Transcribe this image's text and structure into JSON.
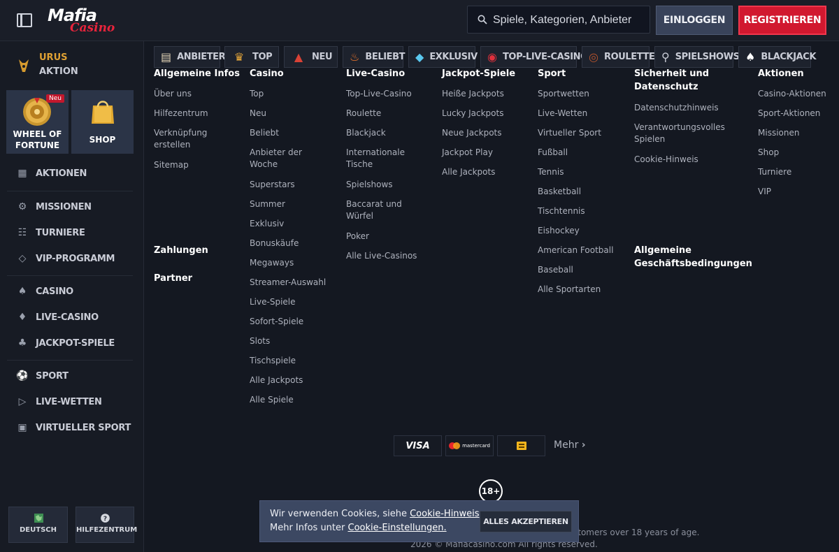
{
  "header": {
    "logo_top": "Mafia",
    "logo_bottom": "Casino",
    "search_placeholder": "Spiele, Kategorien, Anbieter",
    "login_label": "EINLOGGEN",
    "register_label": "REGISTRIEREN"
  },
  "sidebar": {
    "promo_title": "URUS",
    "promo_subtitle": "AKTION",
    "tiles": [
      {
        "label_line1": "WHEEL OF",
        "label_line2": "FORTUNE",
        "badge": "Neu",
        "icon": "wheel-icon"
      },
      {
        "label_line1": "SHOP",
        "label_line2": "",
        "badge": "",
        "icon": "shopping-bag-icon"
      }
    ],
    "items": [
      {
        "label": "AKTIONEN",
        "icon": "gift-icon"
      },
      {
        "label": "MISSIONEN",
        "icon": "gear-icon"
      },
      {
        "label": "TURNIERE",
        "icon": "tournament-icon"
      },
      {
        "label": "VIP-PROGRAMM",
        "icon": "diamond-icon"
      },
      {
        "label": "CASINO",
        "icon": "spade-icon"
      },
      {
        "label": "LIVE-CASINO",
        "icon": "cards-icon"
      },
      {
        "label": "JACKPOT-SPIELE",
        "icon": "clover-icon"
      },
      {
        "label": "SPORT",
        "icon": "football-icon"
      },
      {
        "label": "LIVE-WETTEN",
        "icon": "live-icon"
      },
      {
        "label": "VIRTUELLER SPORT",
        "icon": "virtual-sport-icon"
      }
    ],
    "language_label": "DEUTSCH",
    "help_label": "HILFEZENTRUM"
  },
  "categories": [
    {
      "label": "ANBIETER",
      "icon": "provider-icon"
    },
    {
      "label": "TOP",
      "icon": "crown-icon"
    },
    {
      "label": "NEU",
      "icon": "megaphone-icon"
    },
    {
      "label": "BELIEBT",
      "icon": "flame-icon"
    },
    {
      "label": "EXKLUSIV",
      "icon": "gem-icon"
    },
    {
      "label": "TOP-LIVE-CASINO",
      "icon": "chip-icon"
    },
    {
      "label": "ROULETTE",
      "icon": "roulette-icon"
    },
    {
      "label": "SPIELSHOWS",
      "icon": "microphone-icon"
    },
    {
      "label": "BLACKJACK",
      "icon": "playing-cards-icon"
    }
  ],
  "footer": {
    "columns": [
      {
        "heading": "Allgemeine Infos",
        "links": [
          "Über uns",
          "Hilfezentrum",
          "Verknüpfung erstellen",
          "Sitemap"
        ]
      },
      {
        "heading": "Casino",
        "links": [
          "Top",
          "Neu",
          "Beliebt",
          "Anbieter der Woche",
          "Superstars",
          "Summer",
          "Exklusiv",
          "Bonuskäufe",
          "Megaways",
          "Streamer-Auswahl",
          "Live-Spiele",
          "Sofort-Spiele",
          "Slots",
          "Tischspiele",
          "Alle Jackpots",
          "Alle Spiele"
        ]
      },
      {
        "heading": "Live-Casino",
        "links": [
          "Top-Live-Casino",
          "Roulette",
          "Blackjack",
          "Internationale Tische",
          "Spielshows",
          "Baccarat und Würfel",
          "Poker",
          "Alle Live-Casinos"
        ]
      },
      {
        "heading": "Jackpot-Spiele",
        "links": [
          "Heiße Jackpots",
          "Lucky Jackpots",
          "Neue Jackpots",
          "Jackpot Play",
          "Alle Jackpots"
        ]
      },
      {
        "heading": "Sport",
        "links": [
          "Sportwetten",
          "Live-Wetten",
          "Virtueller Sport",
          "Fußball",
          "Tennis",
          "Basketball",
          "Tischtennis",
          "Eishockey",
          "American Football",
          "Baseball",
          "Alle Sportarten"
        ]
      },
      {
        "heading": "Sicherheit und Datenschutz",
        "links": [
          "Datenschutzhinweis",
          "Verantwortungsvolles Spielen",
          "Cookie-Hinweis"
        ]
      },
      {
        "heading": "Aktionen",
        "links": [
          "Casino-Aktionen",
          "Sport-Aktionen",
          "Missionen",
          "Shop",
          "Turniere",
          "VIP"
        ]
      }
    ],
    "zahlungen": "Zahlungen",
    "partner": "Partner",
    "agb": "Allgemeine Geschäftsbedingungen",
    "payments": [
      {
        "name": "VISA",
        "icon": "visa-icon"
      },
      {
        "name": "mastercard",
        "icon": "mastercard-icon"
      },
      {
        "name": "",
        "icon": "card-chip-icon"
      }
    ],
    "more_label": "Mehr",
    "age_badge": "18+",
    "responsibility_fragment": "stomers over 18 years of age.",
    "copyright": "2026 © Mafiacasino.com All rights reserved."
  },
  "cookie": {
    "line1_prefix": "Wir verwenden Cookies, siehe ",
    "line1_link": "Cookie-Hinweis",
    "line2_prefix": "Mehr Infos unter ",
    "line2_link": "Cookie-Einstellungen.",
    "accept_label": "ALLES AKZEPTIEREN"
  },
  "colors": {
    "background": "#141821",
    "accent_red": "#d1182f",
    "promo_gold": "#e0a133",
    "cookie_banner": "#3c4862"
  }
}
